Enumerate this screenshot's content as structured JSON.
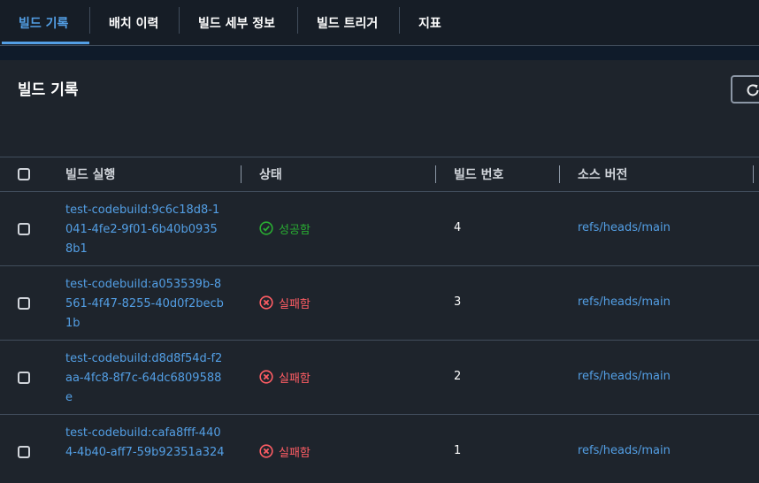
{
  "tabs": [
    {
      "label": "빌드 기록",
      "active": true
    },
    {
      "label": "배치 이력",
      "active": false
    },
    {
      "label": "빌드 세부 정보",
      "active": false
    },
    {
      "label": "빌드 트리거",
      "active": false
    },
    {
      "label": "지표",
      "active": false
    }
  ],
  "panel": {
    "title": "빌드 기록"
  },
  "table": {
    "headers": [
      "빌드 실행",
      "상태",
      "빌드 번호",
      "소스 버전"
    ],
    "rows": [
      {
        "build_run": "test-codebuild:9c6c18d8-1041-4fe2-9f01-6b40b09358b1",
        "status": "성공함",
        "status_type": "success",
        "build_number": "4",
        "source_version": "refs/heads/main"
      },
      {
        "build_run": "test-codebuild:a053539b-8561-4f47-8255-40d0f2becb1b",
        "status": "실패함",
        "status_type": "failed",
        "build_number": "3",
        "source_version": "refs/heads/main"
      },
      {
        "build_run": "test-codebuild:d8d8f54d-f2aa-4fc8-8f7c-64dc6809588e",
        "status": "실패함",
        "status_type": "failed",
        "build_number": "2",
        "source_version": "refs/heads/main"
      },
      {
        "build_run": "test-codebuild:cafa8fff-4404-4b40-aff7-59b92351a324",
        "status": "실패함",
        "status_type": "failed",
        "build_number": "1",
        "source_version": "refs/heads/main"
      }
    ]
  },
  "icons": {
    "refresh": "refresh-icon",
    "success": "check-circle-icon",
    "failed": "x-circle-icon"
  },
  "colors": {
    "accent": "#539fe5",
    "success": "#29ad32",
    "error": "#ff5d64",
    "background": "#1e242c"
  }
}
